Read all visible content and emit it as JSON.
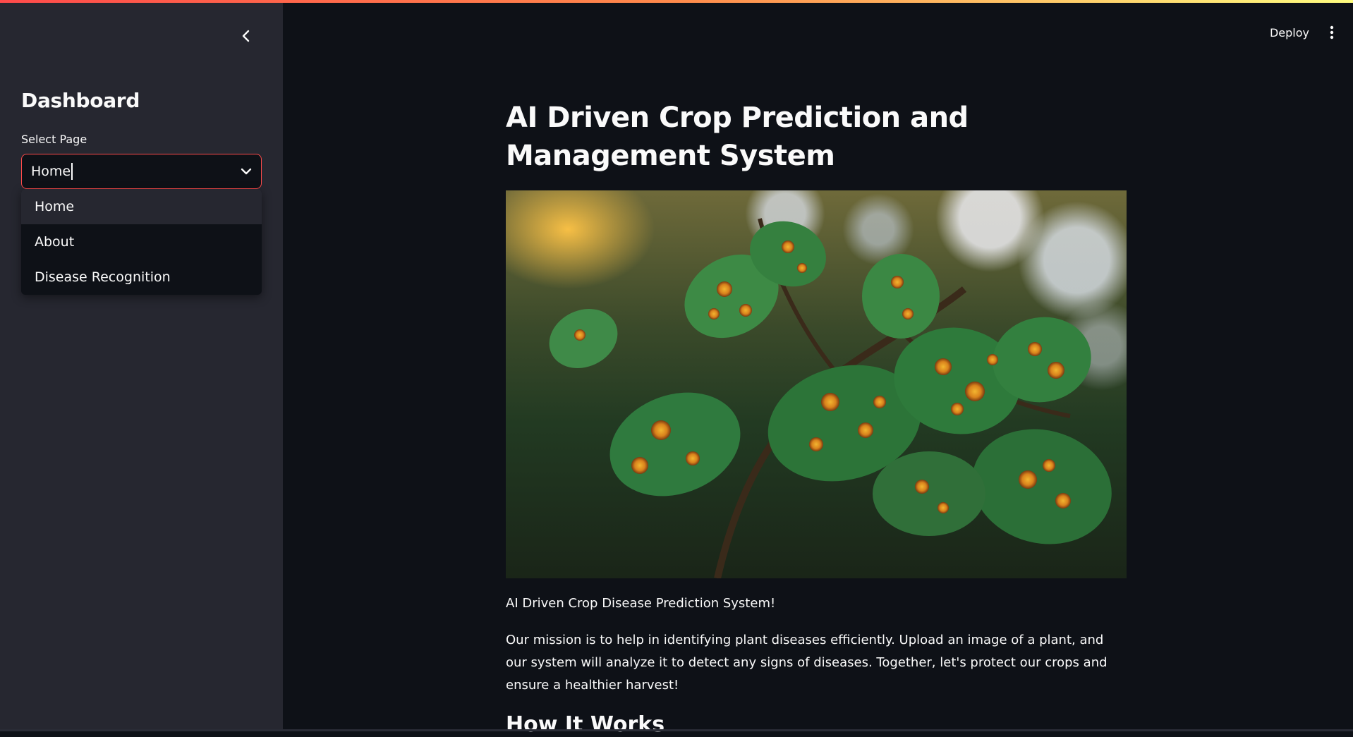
{
  "sidebar": {
    "title": "Dashboard",
    "select_label": "Select Page",
    "select_value": "Home",
    "options": [
      "Home",
      "About",
      "Disease Recognition"
    ]
  },
  "toolbar": {
    "deploy_label": "Deploy"
  },
  "main": {
    "title": "AI Driven Crop Prediction and Management System",
    "hero_image": "diseased-plant-leaves-photo",
    "caption": "AI Driven Crop Disease Prediction System!",
    "paragraph": "Our mission is to help in identifying plant diseases efficiently. Upload an image of a plant, and our system will analyze it to detect any signs of diseases. Together, let's protect our crops and ensure a healthier harvest!",
    "next_heading": "How It Works"
  },
  "colors": {
    "accent": "#ff4b4b",
    "sidebar_bg": "#262730",
    "main_bg": "#0e1117"
  },
  "icons": {
    "collapse": "chevron-left-icon",
    "select": "chevron-down-icon",
    "menu": "vertical-dots-icon"
  }
}
